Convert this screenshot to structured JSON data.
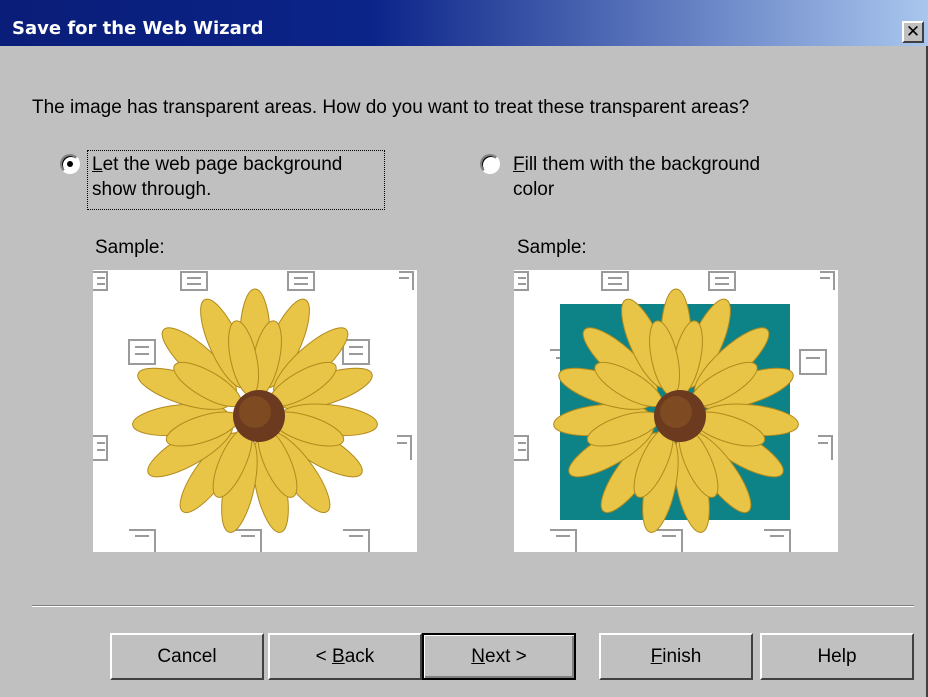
{
  "window": {
    "title": "Save for the Web Wizard",
    "close_label": "✕"
  },
  "prompt": "The image has transparent areas.  How do you want to treat these transparent areas?",
  "options": [
    {
      "line1": "et the web page background",
      "mnemonic": "L",
      "line2": "show through.",
      "selected": true
    },
    {
      "line1": "ill them with the background",
      "mnemonic": "F",
      "line2": "color",
      "selected": false
    }
  ],
  "samples": [
    {
      "label": "Sample:"
    },
    {
      "label": "Sample:"
    }
  ],
  "colors": {
    "fill_background": "#0e8387",
    "petal": "#e8c447",
    "center": "#6b3a1f"
  },
  "buttons": {
    "cancel": {
      "label": "Cancel"
    },
    "back": {
      "prefix": "< ",
      "mnemonic": "B",
      "rest": "ack"
    },
    "next": {
      "mnemonic": "N",
      "rest": "ext >"
    },
    "finish": {
      "mnemonic": "F",
      "rest": "inish"
    },
    "help": {
      "label": "Help"
    }
  }
}
